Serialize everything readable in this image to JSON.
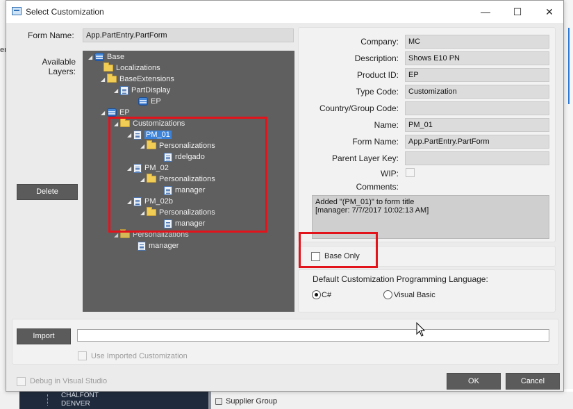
{
  "window": {
    "title": "Select Customization",
    "minimize": "—",
    "maximize": "☐",
    "close": "✕"
  },
  "form_name": {
    "label": "Form Name:",
    "value": "App.PartEntry.PartForm"
  },
  "available_layers_label": "Available\nLayers:",
  "delete_button": "Delete",
  "tree": [
    {
      "label": "Base",
      "icon": "database",
      "expanded": true
    },
    {
      "label": "Localizations",
      "icon": "folder"
    },
    {
      "label": "BaseExtensions",
      "icon": "folder",
      "expanded": true
    },
    {
      "label": "PartDisplay",
      "icon": "page",
      "expanded": true
    },
    {
      "label": "EP",
      "icon": "database"
    },
    {
      "label": "EP",
      "icon": "database",
      "expanded": true
    },
    {
      "label": "Customizations",
      "icon": "folder",
      "expanded": true
    },
    {
      "label": "PM_01",
      "icon": "page",
      "expanded": true,
      "selected": true
    },
    {
      "label": "Personalizations",
      "icon": "folder",
      "expanded": true
    },
    {
      "label": "rdelgado",
      "icon": "page"
    },
    {
      "label": "PM_02",
      "icon": "page",
      "expanded": true
    },
    {
      "label": "Personalizations",
      "icon": "folder",
      "expanded": true
    },
    {
      "label": "manager",
      "icon": "page"
    },
    {
      "label": "PM_02b",
      "icon": "page",
      "expanded": true
    },
    {
      "label": "Personalizations",
      "icon": "folder",
      "expanded": true
    },
    {
      "label": "manager",
      "icon": "page"
    },
    {
      "label": "Personalizations",
      "icon": "folder",
      "expanded": true
    },
    {
      "label": "manager",
      "icon": "page"
    }
  ],
  "details": {
    "company": {
      "label": "Company:",
      "value": "MC"
    },
    "description": {
      "label": "Description:",
      "value": "Shows E10 PN"
    },
    "product_id": {
      "label": "Product ID:",
      "value": "EP"
    },
    "type_code": {
      "label": "Type Code:",
      "value": "Customization"
    },
    "country_group_code": {
      "label": "Country/Group Code:",
      "value": ""
    },
    "name": {
      "label": "Name:",
      "value": "PM_01"
    },
    "form_name": {
      "label": "Form Name:",
      "value": "App.PartEntry.PartForm"
    },
    "parent_layer_key": {
      "label": "Parent Layer Key:",
      "value": ""
    },
    "wip": {
      "label": "WIP:"
    },
    "comments": {
      "label": "Comments:",
      "line1": "Added \"(PM_01)\" to form title",
      "line2": "[manager: 7/7/2017 10:02:13 AM]"
    }
  },
  "base_only": {
    "label": "Base Only",
    "checked": false
  },
  "language": {
    "title": "Default Customization Programming Language:",
    "csharp": "C#",
    "vb": "Visual Basic",
    "selected": "C#"
  },
  "import": {
    "button": "Import",
    "value": "",
    "use_imported": "Use Imported Customization"
  },
  "debug": {
    "label": "Debug in Visual Studio"
  },
  "ok_button": "OK",
  "cancel_button": "Cancel",
  "background": {
    "left_letter": "er",
    "list_line1": "CHALFONT",
    "list_line2": "DENVER",
    "supplier_group": "Supplier Group"
  },
  "colors": {
    "highlight": "#e3131b",
    "selection": "#3c82d8",
    "tree_bg": "#5f5f5f"
  }
}
